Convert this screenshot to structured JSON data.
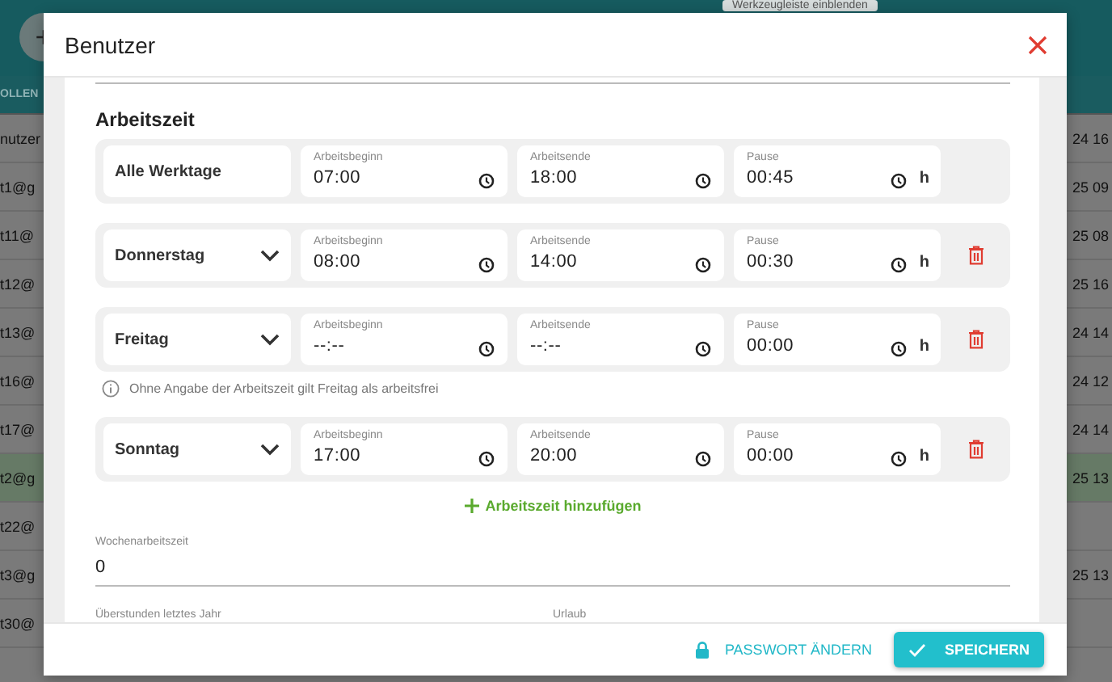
{
  "background": {
    "tooltip": "Werkzeugleiste einblenden",
    "add_button": "+",
    "column_header": "OLLEN",
    "rows": [
      {
        "left": "nutzer",
        "right": "24 16",
        "selected": false
      },
      {
        "left": "t1@g",
        "right": "25 09",
        "selected": false
      },
      {
        "left": "t11@",
        "right": "25 08",
        "selected": false
      },
      {
        "left": "t12@",
        "right": "25 16",
        "selected": false
      },
      {
        "left": "t13@",
        "right": "24 14",
        "selected": false
      },
      {
        "left": "t16@",
        "right": "24 12",
        "selected": false
      },
      {
        "left": "t17@",
        "right": "24 14",
        "selected": false
      },
      {
        "left": "t2@g",
        "right": "25 13",
        "selected": true
      },
      {
        "left": "t22@",
        "selected": false
      },
      {
        "left": "t3@g",
        "right": "25 13",
        "selected": false
      },
      {
        "left": "t30@",
        "selected": false
      }
    ]
  },
  "dialog": {
    "title": "Benutzer",
    "section_title": "Arbeitszeit",
    "work_times": [
      {
        "kind": "all",
        "day": "Alle Werktage",
        "start_label": "Arbeitsbeginn",
        "start": "07:00",
        "end_label": "Arbeitsende",
        "end": "18:00",
        "break_label": "Pause",
        "break": "00:45",
        "unit": "h"
      },
      {
        "kind": "day",
        "day": "Donnerstag",
        "start_label": "Arbeitsbeginn",
        "start": "08:00",
        "end_label": "Arbeitsende",
        "end": "14:00",
        "break_label": "Pause",
        "break": "00:30",
        "unit": "h"
      },
      {
        "kind": "day",
        "day": "Freitag",
        "start_label": "Arbeitsbeginn",
        "start": "--:--",
        "end_label": "Arbeitsende",
        "end": "--:--",
        "break_label": "Pause",
        "break": "00:00",
        "unit": "h",
        "note": "Ohne Angabe der Arbeitszeit gilt Freitag als arbeitsfrei"
      },
      {
        "kind": "day",
        "day": "Sonntag",
        "start_label": "Arbeitsbeginn",
        "start": "17:00",
        "end_label": "Arbeitsende",
        "end": "20:00",
        "break_label": "Pause",
        "break": "00:00",
        "unit": "h"
      }
    ],
    "add_link": "Arbeitszeit hinzufügen",
    "weekly": {
      "label": "Wochenarbeitszeit",
      "value": "0"
    },
    "bottom_labels": [
      "Überstunden letztes Jahr",
      "Urlaub"
    ],
    "change_password": "PASSWORT ÄNDERN",
    "save": "SPEICHERN"
  }
}
